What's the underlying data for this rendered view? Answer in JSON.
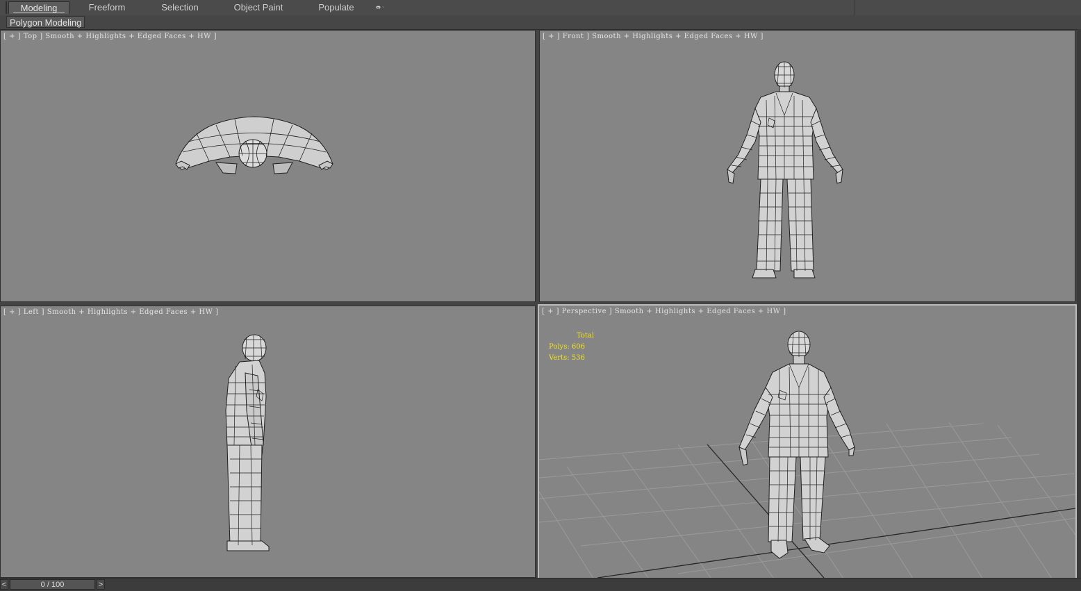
{
  "ribbon": {
    "tabs": [
      {
        "label": "Modeling",
        "active": true
      },
      {
        "label": "Freeform",
        "active": false
      },
      {
        "label": "Selection",
        "active": false
      },
      {
        "label": "Object Paint",
        "active": false
      },
      {
        "label": "Populate",
        "active": false
      }
    ],
    "toggle_icon": "ribbon-display-toggle-icon",
    "panel_label": "Polygon Modeling"
  },
  "viewports": {
    "top": {
      "label": "[ + ] Top ] Smooth + Highlights + Edged Faces + HW ]"
    },
    "front": {
      "label": "[ + ] Front ] Smooth + Highlights + Edged Faces + HW ]"
    },
    "left": {
      "label": "[ + ] Left ] Smooth + Highlights + Edged Faces + HW ]"
    },
    "perspective": {
      "label": "[ + ] Perspective ] Smooth + Highlights + Edged Faces + HW ]",
      "active": true,
      "stats": {
        "header": "Total",
        "polys_label": "Polys:",
        "polys_value": "606",
        "verts_label": "Verts:",
        "verts_value": "536"
      }
    }
  },
  "timeline": {
    "prev_label": "<",
    "next_label": ">",
    "frame_display": "0 / 100"
  },
  "colors": {
    "viewport_bg": "#858585",
    "stats_text": "#f2e21f",
    "ui_bg": "#444444"
  }
}
